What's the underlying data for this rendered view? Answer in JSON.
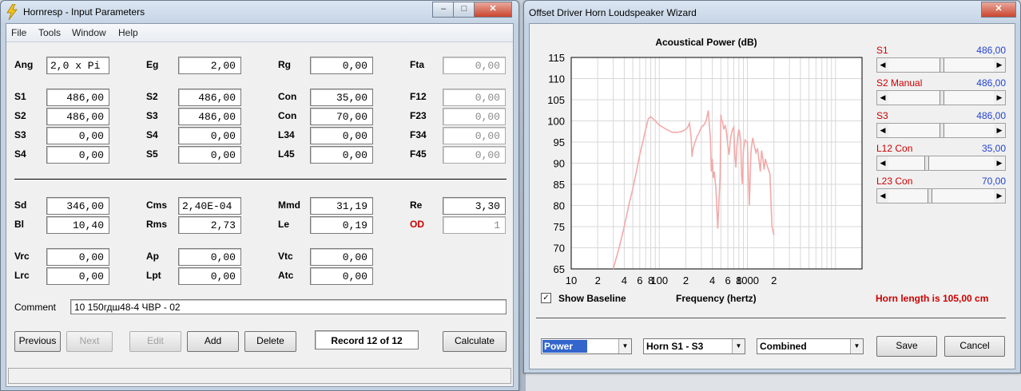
{
  "left_window": {
    "title": "Hornresp - Input Parameters",
    "controls": {
      "minimize": "–",
      "maximize": "□",
      "close": "✕"
    },
    "menu": [
      "File",
      "Tools",
      "Window",
      "Help"
    ],
    "params": {
      "Ang": {
        "label": "Ang",
        "value": "2,0 x Pi"
      },
      "Eg": {
        "label": "Eg",
        "value": "2,00"
      },
      "Rg": {
        "label": "Rg",
        "value": "0,00"
      },
      "Fta": {
        "label": "Fta",
        "value": "0,00"
      },
      "S1": {
        "label": "S1",
        "value": "486,00"
      },
      "S2a": {
        "label": "S2",
        "value": "486,00"
      },
      "Con1": {
        "label": "Con",
        "value": "35,00"
      },
      "F12": {
        "label": "F12",
        "value": "0,00"
      },
      "S2b": {
        "label": "S2",
        "value": "486,00"
      },
      "S3a": {
        "label": "S3",
        "value": "486,00"
      },
      "Con2": {
        "label": "Con",
        "value": "70,00"
      },
      "F23": {
        "label": "F23",
        "value": "0,00"
      },
      "S3b": {
        "label": "S3",
        "value": "0,00"
      },
      "S4a": {
        "label": "S4",
        "value": "0,00"
      },
      "L34": {
        "label": "L34",
        "value": "0,00"
      },
      "F34": {
        "label": "F34",
        "value": "0,00"
      },
      "S4b": {
        "label": "S4",
        "value": "0,00"
      },
      "S5": {
        "label": "S5",
        "value": "0,00"
      },
      "L45": {
        "label": "L45",
        "value": "0,00"
      },
      "F45": {
        "label": "F45",
        "value": "0,00"
      },
      "Sd": {
        "label": "Sd",
        "value": "346,00"
      },
      "Cms": {
        "label": "Cms",
        "value": "2,40E-04"
      },
      "Mmd": {
        "label": "Mmd",
        "value": "31,19"
      },
      "Re": {
        "label": "Re",
        "value": "3,30"
      },
      "Bl": {
        "label": "Bl",
        "value": "10,40"
      },
      "Rms": {
        "label": "Rms",
        "value": "2,73"
      },
      "Le": {
        "label": "Le",
        "value": "0,19"
      },
      "OD": {
        "label": "OD",
        "value": "1"
      },
      "Vrc": {
        "label": "Vrc",
        "value": "0,00"
      },
      "Ap": {
        "label": "Ap",
        "value": "0,00"
      },
      "Vtc": {
        "label": "Vtc",
        "value": "0,00"
      },
      "Lrc": {
        "label": "Lrc",
        "value": "0,00"
      },
      "Lpt": {
        "label": "Lpt",
        "value": "0,00"
      },
      "Atc": {
        "label": "Atc",
        "value": "0,00"
      }
    },
    "comment_label": "Comment",
    "comment_value": "10 150гдш48-4 ЧВР - 02",
    "buttons": {
      "previous": "Previous",
      "next": "Next",
      "edit": "Edit",
      "add": "Add",
      "delete": "Delete",
      "calculate": "Calculate"
    },
    "record": "Record 12 of 12",
    "colors": {
      "od_label": "#cc0000"
    }
  },
  "right_window": {
    "title": "Offset Driver Horn Loudspeaker Wizard",
    "close": "✕",
    "show_baseline_label": "Show Baseline",
    "show_baseline_checked": "✓",
    "horn_length": "Horn length is 105,00 cm",
    "sliders": [
      {
        "label": "S1",
        "value": "486,00",
        "position": 0.5
      },
      {
        "label": "S2 Manual",
        "value": "486,00",
        "position": 0.5
      },
      {
        "label": "S3",
        "value": "486,00",
        "position": 0.5
      },
      {
        "label": "L12 Con",
        "value": "35,00",
        "position": 0.35
      },
      {
        "label": "L23 Con",
        "value": "70,00",
        "position": 0.38
      }
    ],
    "combos": {
      "mode": "Power",
      "horn": "Horn S1 - S3",
      "combined": "Combined"
    },
    "buttons": {
      "save": "Save",
      "cancel": "Cancel"
    },
    "colors": {
      "curve": "#f2aaaa",
      "slider_label": "#cc0000",
      "slider_value": "#2244cc",
      "horn_length": "#cc0000",
      "grid": "#d8d8d8"
    }
  },
  "chart_data": {
    "type": "line",
    "title": "Acoustical Power (dB)",
    "xlabel": "Frequency (hertz)",
    "ylabel": "",
    "x_scale": "log",
    "xlim": [
      10,
      20000
    ],
    "ylim": [
      65,
      115
    ],
    "yticks": [
      "115",
      "110",
      "105",
      "100",
      "95",
      "90",
      "85",
      "80",
      "75",
      "70",
      "65"
    ],
    "xticks": [
      "10",
      "2",
      "4",
      "6",
      "8",
      "100",
      "2",
      "4",
      "6",
      "8",
      "1000",
      "2"
    ],
    "series": [
      {
        "x": [
          30,
          35,
          40,
          45,
          50,
          55,
          60,
          65,
          70,
          75,
          80,
          90,
          100,
          120,
          140,
          160,
          180,
          200,
          210,
          220,
          230,
          235,
          240,
          250,
          260,
          270,
          280,
          300,
          320,
          340,
          360,
          380,
          390,
          400,
          410,
          420,
          440,
          460,
          480,
          490,
          500,
          510,
          520,
          540,
          560,
          580,
          600,
          620,
          640,
          660,
          680,
          700,
          720,
          740,
          760,
          780,
          800,
          820,
          840,
          860,
          880,
          900,
          940,
          980,
          1000,
          1050,
          1100,
          1150,
          1200,
          1250,
          1300,
          1350,
          1400,
          1450,
          1500,
          1550,
          1600,
          1700,
          1800,
          1900,
          2000
        ],
        "y": [
          65,
          70,
          75,
          80,
          84,
          88,
          92,
          95,
          98,
          100.5,
          101,
          100,
          99,
          98,
          97.3,
          97.3,
          97.5,
          98,
          98.5,
          99.5,
          96,
          91.5,
          93,
          94.5,
          95.5,
          96.5,
          97,
          98.5,
          99,
          100,
          102.5,
          96,
          88,
          91,
          86.5,
          88,
          84,
          74.5,
          83,
          87,
          101.5,
          100,
          100,
          98,
          99,
          97,
          94,
          92,
          95.5,
          97,
          98,
          98.5,
          92,
          89,
          94,
          96.5,
          98,
          97,
          95,
          87,
          85,
          93,
          95.5,
          95,
          95,
          80,
          93,
          96,
          94,
          92.5,
          93.5,
          91,
          88,
          93,
          91,
          88.5,
          91,
          89,
          87.5,
          75,
          73
        ]
      }
    ]
  }
}
